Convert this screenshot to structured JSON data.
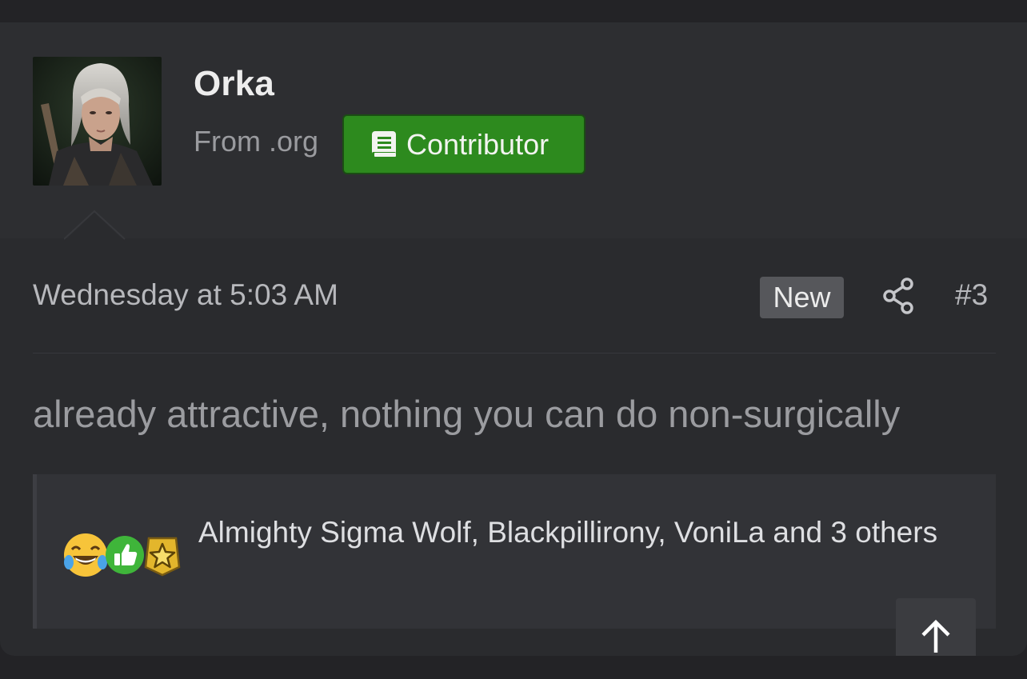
{
  "post": {
    "author": {
      "name": "Orka",
      "from": "From .org",
      "badge": {
        "label": "Contributor",
        "icon": "book-icon",
        "color": "#2d8a1e"
      },
      "avatar": "avatar-image"
    },
    "date": "Wednesday at 5:03 AM",
    "new_label": "New",
    "share_icon": "share-icon",
    "number": "#3",
    "body": "already attractive, nothing you can do non-surgically",
    "reactions": {
      "icons": [
        "laughing-crying-emoji-icon",
        "thumbs-up-icon",
        "star-badge-icon"
      ],
      "text": "Almighty Sigma Wolf, Blackpillirony, VoniLa and 3 others"
    }
  },
  "scroll_top_icon": "arrow-up-icon",
  "colors": {
    "background": "#232326",
    "card": "#2a2b2e",
    "accent_green": "#2d8a1e",
    "new_badge": "#56575b"
  }
}
